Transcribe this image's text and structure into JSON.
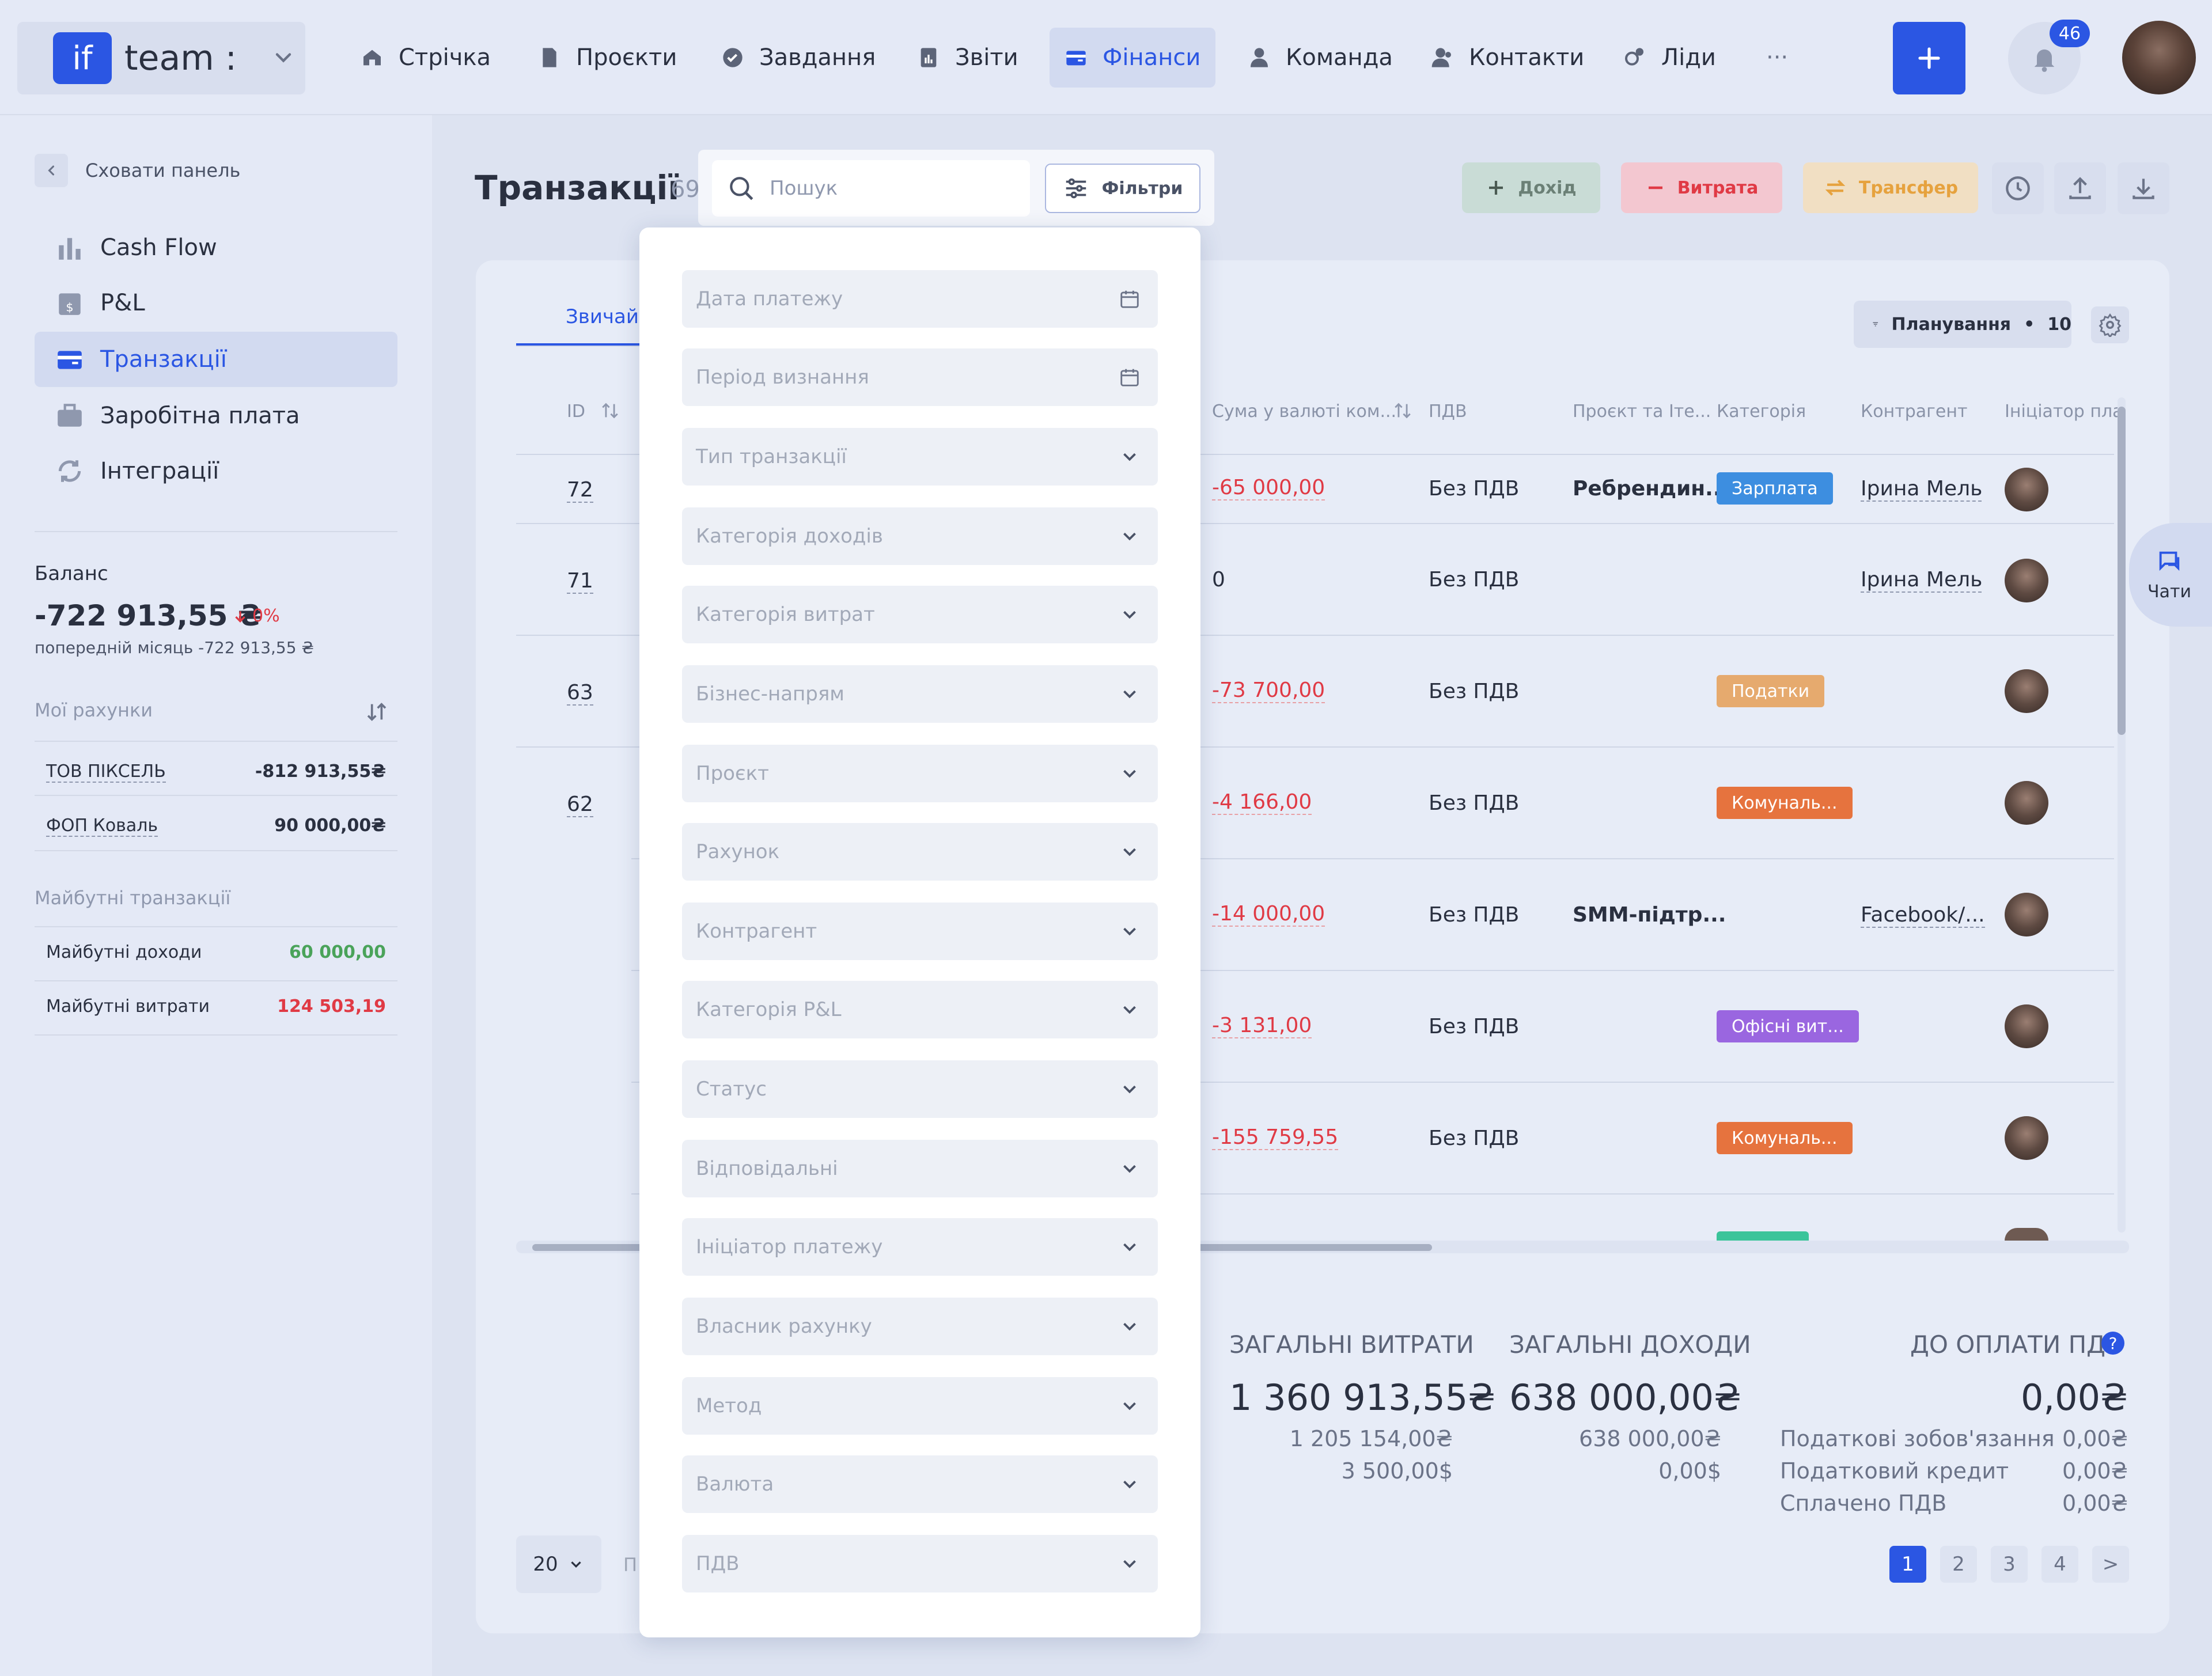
{
  "brand": {
    "logo": "if",
    "name": "team :"
  },
  "nav": [
    {
      "label": "Стрічка",
      "icon": "home-icon"
    },
    {
      "label": "Проєкти",
      "icon": "file-icon"
    },
    {
      "label": "Завдання",
      "icon": "check-circle-icon"
    },
    {
      "label": "Звіти",
      "icon": "report-icon"
    },
    {
      "label": "Фінанси",
      "icon": "wallet-icon",
      "active": true
    },
    {
      "label": "Команда",
      "icon": "user-icon"
    },
    {
      "label": "Контакти",
      "icon": "contacts-icon"
    },
    {
      "label": "Ліди",
      "icon": "leads-icon"
    }
  ],
  "nav_more": "···",
  "notifications": {
    "count": "46"
  },
  "sidebar": {
    "hide_label": "Сховати панель",
    "items": [
      {
        "label": "Cash Flow"
      },
      {
        "label": "P&L"
      },
      {
        "label": "Транзакції",
        "active": true
      },
      {
        "label": "Заробітна плата"
      },
      {
        "label": "Інтеграції"
      }
    ],
    "balance": {
      "title": "Баланс",
      "value": "-722 913,55 ₴",
      "change": "0%",
      "previous": "попередній місяць -722 913,55 ₴"
    },
    "accounts_title": "Мої рахунки",
    "accounts": [
      {
        "name": "ТОВ ПІКСЕЛЬ",
        "amount": "-812 913,55₴"
      },
      {
        "name": "ФОП Коваль",
        "amount": "90 000,00₴"
      }
    ],
    "future_title": "Майбутні транзакції",
    "future": [
      {
        "name": "Майбутні доходи",
        "amount": "60 000,00"
      },
      {
        "name": "Майбутні витрати",
        "amount": "124 503,19"
      }
    ]
  },
  "page": {
    "title": "Транзакції",
    "count": "69"
  },
  "search": {
    "placeholder": "Пошук",
    "filters_label": "Фільтри"
  },
  "actions": {
    "income": "Дохід",
    "expense": "Витрата",
    "transfer": "Трансфер"
  },
  "tab_active": "Звичайні",
  "planning": {
    "label": "Планування",
    "count": "10"
  },
  "columns": {
    "id": "ID",
    "sum": "Сума у валюті ком...",
    "vat": "ПДВ",
    "project": "Проєкт та Іте...",
    "category": "Категорія",
    "counterparty": "Контрагент",
    "initiator": "Ініціатор пла"
  },
  "rows": [
    {
      "id": "72",
      "sum": "-65 000,00",
      "vat": "Без ПДВ",
      "project": "Ребрендин...",
      "category": "Зарплата",
      "category_color": "#3d8ee0",
      "counterparty": "Ірина Мельн"
    },
    {
      "id": "71",
      "sum": "0",
      "vat": "Без ПДВ",
      "project": "",
      "category": "",
      "category_color": "",
      "counterparty": "Ірина Мельн"
    },
    {
      "id": "63",
      "sum": "-73 700,00",
      "vat": "Без ПДВ",
      "project": "",
      "category": "Податки",
      "category_color": "#e6aa6e",
      "counterparty": ""
    },
    {
      "id": "62",
      "sum": "-4 166,00",
      "vat": "Без ПДВ",
      "project": "",
      "category": "Комуналь...",
      "category_color": "#e6733e",
      "counterparty": ""
    },
    {
      "id": "",
      "sum": "-14 000,00",
      "vat": "Без ПДВ",
      "project": "SMM-підтр...",
      "category": "",
      "category_color": "",
      "counterparty": "Facebook/..."
    },
    {
      "id": "",
      "sum": "-3 131,00",
      "vat": "Без ПДВ",
      "project": "",
      "category": "Офісні вит...",
      "category_color": "#9a66e0",
      "counterparty": ""
    },
    {
      "id": "",
      "sum": "-155 759,55",
      "vat": "Без ПДВ",
      "project": "",
      "category": "Комуналь...",
      "category_color": "#e6733e",
      "counterparty": ""
    }
  ],
  "filters": [
    {
      "label": "Дата платежу",
      "type": "date"
    },
    {
      "label": "Період визнання",
      "type": "date"
    },
    {
      "label": "Тип транзакції",
      "type": "select"
    },
    {
      "label": "Категорія доходів",
      "type": "select"
    },
    {
      "label": "Категорія витрат",
      "type": "select"
    },
    {
      "label": "Бізнес-напрям",
      "type": "select"
    },
    {
      "label": "Проєкт",
      "type": "select"
    },
    {
      "label": "Рахунок",
      "type": "select"
    },
    {
      "label": "Контрагент",
      "type": "select"
    },
    {
      "label": "Категорія P&L",
      "type": "select"
    },
    {
      "label": "Статус",
      "type": "select"
    },
    {
      "label": "Відповідальні",
      "type": "select"
    },
    {
      "label": "Ініціатор платежу",
      "type": "select"
    },
    {
      "label": "Власник рахунку",
      "type": "select"
    },
    {
      "label": "Метод",
      "type": "select"
    },
    {
      "label": "Валюта",
      "type": "select"
    },
    {
      "label": "ПДВ",
      "type": "select"
    }
  ],
  "summary": {
    "expenses": {
      "title": "ЗАГАЛЬНІ ВИТРАТИ",
      "total": "1 360 913,55₴",
      "uah": "1 205 154,00₴",
      "usd": "3 500,00$"
    },
    "income": {
      "title": "ЗАГАЛЬНІ ДОХОДИ",
      "total": "638 000,00₴",
      "uah": "638 000,00₴",
      "usd": "0,00$"
    },
    "vat": {
      "title": "ДО ОПЛАТИ ПДВ",
      "total": "0,00₴",
      "lines": [
        {
          "label": "Податкові зобов'язання",
          "value": "0,00₴"
        },
        {
          "label": "Податковий кредит",
          "value": "0,00₴"
        },
        {
          "label": "Сплачено ПДВ",
          "value": "0,00₴"
        }
      ]
    }
  },
  "pagination": {
    "per_page": "20",
    "label_fragment": "П",
    "pages": [
      "1",
      "2",
      "3",
      "4"
    ],
    "current": "1",
    "next": ">"
  },
  "chats_label": "Чати",
  "colors": {
    "accent": "#2b56e3",
    "negative": "#e03a45",
    "positive": "#4aa35a"
  }
}
